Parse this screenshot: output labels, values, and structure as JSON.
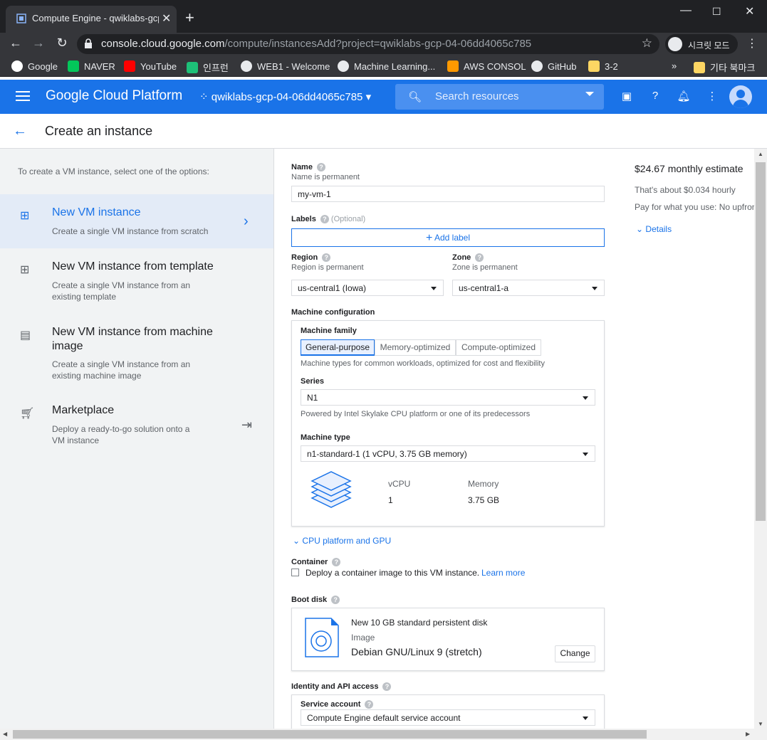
{
  "browser": {
    "tab_title": "Compute Engine - qwiklabs-gcp",
    "url_host": "console.cloud.google.com",
    "url_path": "/compute/instancesAdd?project=qwiklabs-gcp-04-06dd4065c785",
    "incognito_label": "시크릿 모드",
    "bookmarks": [
      "Google",
      "NAVER",
      "YouTube",
      "인프런",
      "WEB1 - Welcome",
      "Machine Learning...",
      "AWS CONSOL",
      "GitHub",
      "3-2"
    ],
    "more_bookmarks": "»",
    "other_bookmarks": "기타 북마크"
  },
  "gcp": {
    "brand": "Google Cloud Platform",
    "project": "qwiklabs-gcp-04-06dd4065c785",
    "search_placeholder": "Search resources"
  },
  "page": {
    "title": "Create an instance"
  },
  "left": {
    "hint": "To create a VM instance, select one of the options:",
    "options": [
      {
        "title": "New VM instance",
        "desc": "Create a single VM instance from scratch"
      },
      {
        "title": "New VM instance from template",
        "desc": "Create a single VM instance from an existing template"
      },
      {
        "title": "New VM instance from machine image",
        "desc": "Create a single VM instance from an existing machine image"
      },
      {
        "title": "Marketplace",
        "desc": "Deploy a ready-to-go solution onto a VM instance"
      }
    ]
  },
  "form": {
    "name_label": "Name",
    "name_sub": "Name is permanent",
    "name_value": "my-vm-1",
    "labels_label": "Labels",
    "labels_optional": "(Optional)",
    "add_label": "Add label",
    "region_label": "Region",
    "region_sub": "Region is permanent",
    "region_value": "us-central1 (Iowa)",
    "zone_label": "Zone",
    "zone_sub": "Zone is permanent",
    "zone_value": "us-central1-a",
    "machine_config_label": "Machine configuration",
    "machine_family_label": "Machine family",
    "family_tabs": [
      "General-purpose",
      "Memory-optimized",
      "Compute-optimized"
    ],
    "family_desc": "Machine types for common workloads, optimized for cost and flexibility",
    "series_label": "Series",
    "series_value": "N1",
    "series_desc": "Powered by Intel Skylake CPU platform or one of its predecessors",
    "machine_type_label": "Machine type",
    "machine_type_value": "n1-standard-1 (1 vCPU, 3.75 GB memory)",
    "vcpu_label": "vCPU",
    "vcpu_value": "1",
    "memory_label": "Memory",
    "memory_value": "3.75 GB",
    "cpu_gpu_link": "CPU platform and GPU",
    "container_label": "Container",
    "container_text": "Deploy a container image to this VM instance.",
    "learn_more": "Learn more",
    "boot_disk_label": "Boot disk",
    "boot_disk_title": "New 10 GB standard persistent disk",
    "boot_image_label": "Image",
    "boot_image_value": "Debian GNU/Linux 9 (stretch)",
    "change_button": "Change",
    "identity_label": "Identity and API access",
    "service_account_label": "Service account",
    "service_account_value": "Compute Engine default service account"
  },
  "estimate": {
    "title": "$24.67 monthly estimate",
    "hourly": "That's about $0.034 hourly",
    "pay": "Pay for what you use: No upfront",
    "details": "Details"
  },
  "colors": {
    "accent": "#1a73e8",
    "selected_bg": "#e3ebf7"
  }
}
